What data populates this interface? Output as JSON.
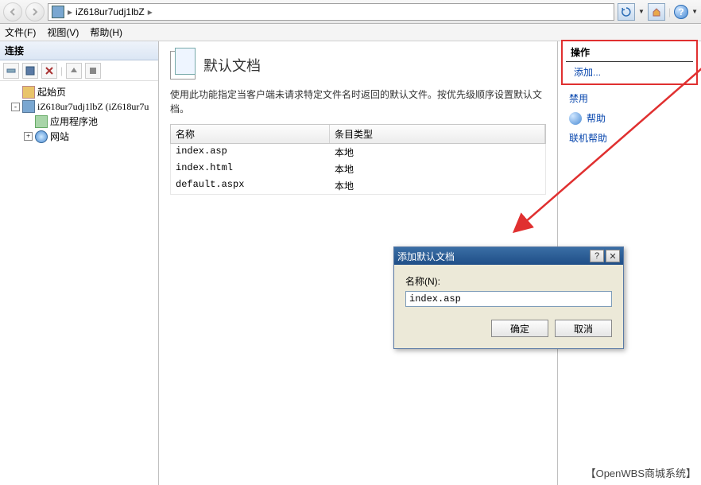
{
  "toolbar": {
    "breadcrumb_root": "iZ618ur7udj1lbZ",
    "breadcrumb_sep": "▸"
  },
  "menubar": {
    "file": "文件(F)",
    "view": "视图(V)",
    "help": "帮助(H)"
  },
  "left": {
    "title": "连接",
    "items": {
      "start": "起始页",
      "server": "iZ618ur7udj1lbZ (iZ618ur7u",
      "app_pool": "应用程序池",
      "sites": "网站"
    }
  },
  "center": {
    "title": "默认文档",
    "desc": "使用此功能指定当客户端未请求特定文件名时返回的默认文件。按优先级顺序设置默认文档。",
    "columns": {
      "name": "名称",
      "type": "条目类型"
    },
    "rows": [
      {
        "name": "index.asp",
        "type": "本地"
      },
      {
        "name": "index.html",
        "type": "本地"
      },
      {
        "name": "default.aspx",
        "type": "本地"
      }
    ]
  },
  "dialog": {
    "title": "添加默认文档",
    "name_label": "名称(N):",
    "input_value": "index.asp",
    "ok": "确定",
    "cancel": "取消"
  },
  "right": {
    "title": "操作",
    "add": "添加...",
    "disable": "禁用",
    "help": "帮助",
    "online_help": "联机帮助"
  },
  "watermark": "【OpenWBS商城系统】"
}
